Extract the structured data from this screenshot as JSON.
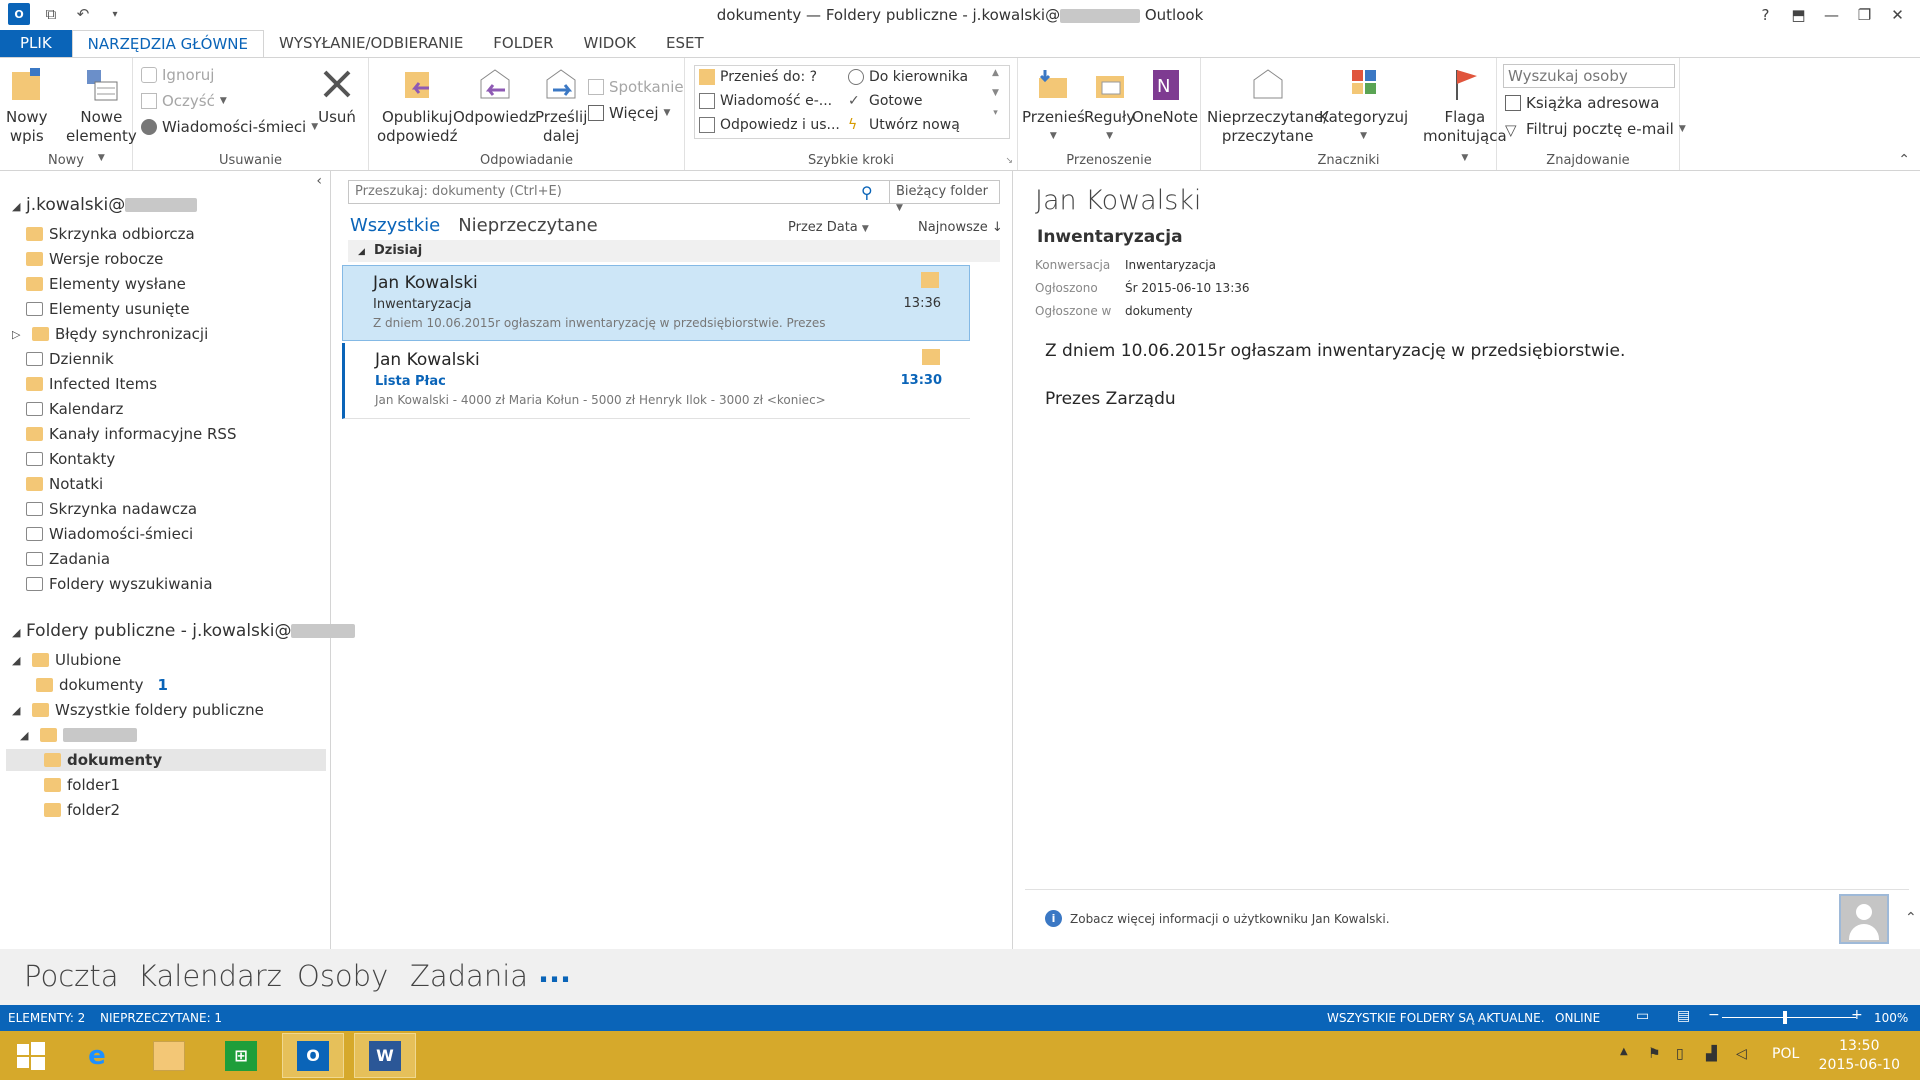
{
  "window": {
    "title_prefix": "dokumenty — Foldery publiczne - j.kowalski@",
    "title_suffix": " Outlook"
  },
  "ribbon_tabs": [
    "PLIK",
    "NARZĘDZIA GŁÓWNE",
    "WYSYŁANIE/ODBIERANIE",
    "FOLDER",
    "WIDOK",
    "ESET"
  ],
  "ribbon": {
    "nowy": {
      "label": "Nowy",
      "new_post": [
        "Nowy",
        "wpis"
      ],
      "new_items": [
        "Nowe",
        "elementy"
      ]
    },
    "usuwanie": {
      "label": "Usuwanie",
      "ignore": "Ignoruj",
      "cleanup": "Oczyść",
      "junk": "Wiadomości-śmieci",
      "delete": "Usuń"
    },
    "odpowiadanie": {
      "label": "Odpowiadanie",
      "post_reply": [
        "Opublikuj",
        "odpowiedź"
      ],
      "reply": "Odpowiedz",
      "forward": [
        "Prześlij",
        "dalej"
      ],
      "meeting": "Spotkanie",
      "more": "Więcej"
    },
    "szybkie_kroki": {
      "label": "Szybkie kroki",
      "items": [
        "Przenieś do: ?",
        "Wiadomość e-...",
        "Odpowiedz i us...",
        "Do kierownika",
        "Gotowe",
        "Utwórz nową"
      ]
    },
    "przenoszenie": {
      "label": "Przenoszenie",
      "move": "Przenieś",
      "rules": "Reguły",
      "onenote": "OneNote"
    },
    "znaczniki": {
      "label": "Znaczniki",
      "unread_read": [
        "Nieprzeczytane/",
        "przeczytane"
      ],
      "categorize": "Kategoryzuj",
      "followup": [
        "Flaga",
        "monitująca"
      ]
    },
    "znajdowanie": {
      "label": "Znajdowanie",
      "search_people": "Wyszukaj osoby",
      "address_book": "Książka adresowa",
      "filter_email": "Filtruj pocztę e-mail"
    }
  },
  "folder_pane": {
    "account": "j.kowalski@",
    "folders": [
      "Skrzynka odbiorcza",
      "Wersje robocze",
      "Elementy wysłane",
      "Elementy usunięte",
      "Błędy synchronizacji",
      "Dziennik",
      "Infected Items",
      "Kalendarz",
      "Kanały informacyjne RSS",
      "Kontakty",
      "Notatki",
      "Skrzynka nadawcza",
      "Wiadomości-śmieci",
      "Zadania",
      "Foldery wyszukiwania"
    ],
    "public_root": "Foldery publiczne - j.kowalski@",
    "favorites": "Ulubione",
    "favorite_item": "dokumenty",
    "favorite_count": "1",
    "all_public": "Wszystkie foldery publiczne",
    "subfolders": [
      "dokumenty",
      "folder1",
      "folder2"
    ]
  },
  "message_list": {
    "search_placeholder": "Przeszukaj: dokumenty (Ctrl+E)",
    "search_scope": "Bieżący folder",
    "filter_all": "Wszystkie",
    "filter_unread": "Nieprzeczytane",
    "sort_by": "Przez Data",
    "sort_order": "Najnowsze",
    "group_today": "Dzisiaj",
    "messages": [
      {
        "from": "Jan Kowalski",
        "subject": "Inwentaryzacja",
        "preview": "Z dniem 10.06.2015r ogłaszam inwentaryzację w przedsiębiorstwie.  Prezes",
        "time": "13:36"
      },
      {
        "from": "Jan Kowalski",
        "subject": "Lista Płac",
        "preview": "Jan Kowalski - 4000 zł  Maria Kołun - 5000 zł  Henryk Ilok - 3000 zł <koniec>",
        "time": "13:30"
      }
    ]
  },
  "reading_pane": {
    "from": "Jan Kowalski",
    "subject": "Inwentaryzacja",
    "meta": [
      {
        "k": "Konwersacja",
        "v": "Inwentaryzacja"
      },
      {
        "k": "Ogłoszono",
        "v": "Śr 2015-06-10 13:36"
      },
      {
        "k": "Ogłoszone w",
        "v": "dokumenty"
      }
    ],
    "body_line1": "Z dniem 10.06.2015r ogłaszam inwentaryzację w przedsiębiorstwie.",
    "body_line2": "Prezes Zarządu",
    "people_info": "Zobacz więcej informacji o użytkowniku Jan Kowalski."
  },
  "nav": [
    "Poczta",
    "Kalendarz",
    "Osoby",
    "Zadania",
    "..."
  ],
  "status": {
    "items": "ELEMENTY: 2",
    "unread": "NIEPRZECZYTANE: 1",
    "sync": "WSZYSTKIE FOLDERY SĄ AKTUALNE.",
    "online": "ONLINE",
    "zoom": "100%"
  },
  "taskbar": {
    "lang": "POL",
    "time": "13:50",
    "date": "2015-06-10"
  },
  "colors": {
    "accent": "#0a64b8",
    "taskbar": "#d6a92b",
    "selected_row": "#cde6f7"
  }
}
